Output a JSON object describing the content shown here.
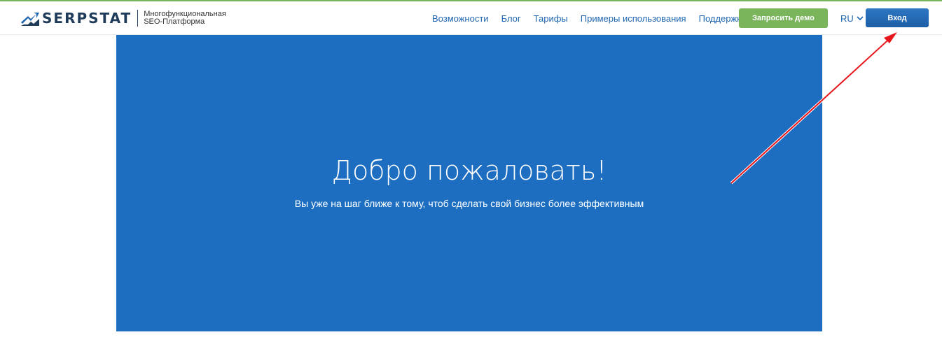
{
  "header": {
    "logo_text": "SERPSTAT",
    "tagline": "Многофункциональная SEO-Платформа",
    "nav": [
      {
        "label": "Возможности"
      },
      {
        "label": "Блог"
      },
      {
        "label": "Тарифы"
      },
      {
        "label": "Примеры использования"
      },
      {
        "label": "Поддержка"
      }
    ],
    "demo_button": "Запросить демо",
    "language": "RU",
    "login_button": "Вход"
  },
  "hero": {
    "title": "Добро пожаловать!",
    "subtitle": "Вы уже на шаг ближе к тому, чтоб сделать свой бизнес более эффективным"
  },
  "colors": {
    "brand_green": "#7ab55c",
    "brand_blue": "#1d6ec0",
    "link_blue": "#1f66b1",
    "logo_dark": "#1e3c5a",
    "annotation_red": "#e8141b"
  }
}
